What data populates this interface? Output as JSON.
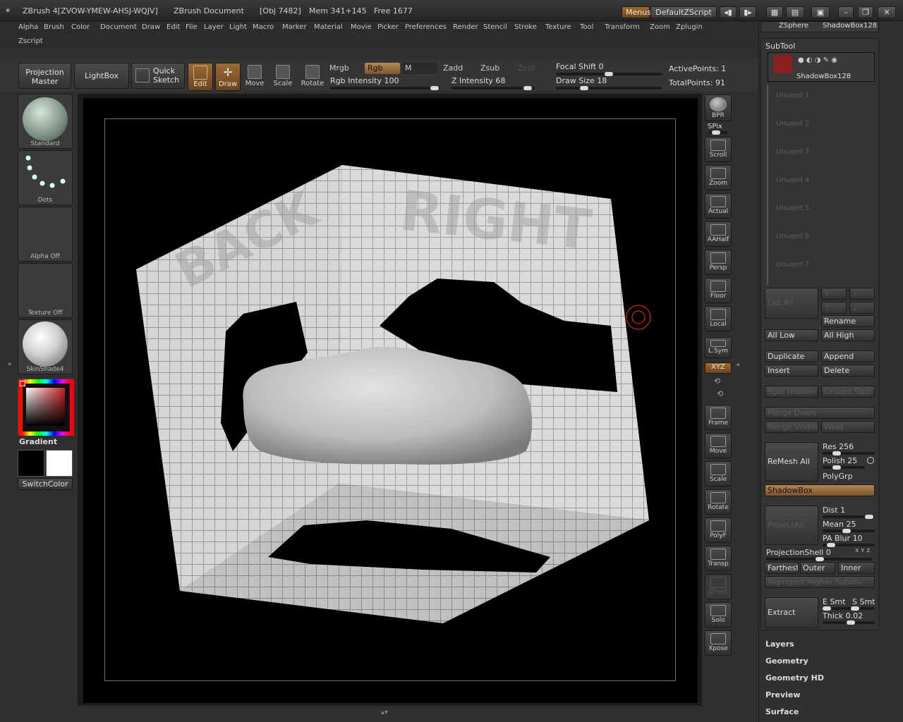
{
  "title_bar": {
    "app_title": "ZBrush 4[ZVOW-YMEW-AHSJ-WQJV]",
    "document": "ZBrush Document",
    "obj": "[Obj 7482]",
    "mem": "Mem 341+145",
    "free": "Free 1677",
    "menus_label": "Menus",
    "zscript_label": "DefaultZScript"
  },
  "menu_bar": {
    "items": [
      "Alpha",
      "Brush",
      "Color",
      "Document",
      "Draw",
      "Edit",
      "File",
      "Layer",
      "Light",
      "Macro",
      "Marker",
      "Material",
      "Movie",
      "Picker",
      "Preferences",
      "Render",
      "Stencil",
      "Stroke",
      "Texture",
      "Tool",
      "Transform",
      "Zoom",
      "Zplugin"
    ],
    "row2": "Zscript"
  },
  "toolbar": {
    "projection_master": "Projection Master",
    "lightbox": "LightBox",
    "quick_sketch": "Quick Sketch",
    "edit": "Edit",
    "draw": "Draw",
    "move": "Move",
    "scale": "Scale",
    "rotate": "Rotate",
    "mrgb": "Mrgb",
    "rgb": "Rgb",
    "m": "M",
    "zadd": "Zadd",
    "zsub": "Zsub",
    "zcut": "Zcut",
    "rgb_intensity_label": "Rgb Intensity",
    "rgb_intensity": "100",
    "z_intensity_label": "Z Intensity",
    "z_intensity": "68",
    "focal_shift_label": "Focal Shift",
    "focal_shift": "0",
    "draw_size_label": "Draw Size",
    "draw_size": "18",
    "active_points_label": "ActivePoints:",
    "active_points": "1",
    "total_points_label": "TotalPoints:",
    "total_points": "91"
  },
  "left_shelf": {
    "brush": "Standard",
    "stroke": "Dots",
    "alpha": "Alpha Off",
    "texture": "Texture Off",
    "material": "SkinShade4",
    "gradient": "Gradient",
    "switch_color": "SwitchColor"
  },
  "canvas": {
    "back_label": "BACK",
    "right_label": "RIGHT"
  },
  "right_shelf": {
    "items": [
      "BPR",
      "SPix",
      "Scroll",
      "Zoom",
      "Actual",
      "AAHalf",
      "Persp",
      "Floor",
      "Local",
      "L.Sym",
      "XYZ",
      "Frame",
      "Move",
      "Scale",
      "Rotate",
      "PolyF",
      "Transp",
      "Ghost",
      "Solo",
      "Xpose"
    ]
  },
  "right_panel": {
    "tool_current": "ZSphere",
    "tool_shadowbox": "ShadowBox128",
    "subtool_title": "SubTool",
    "subtool_item": "ShadowBox128",
    "unused": [
      "Unused 1",
      "Unused 2",
      "Unused 3",
      "Unused 4",
      "Unused 5",
      "Unused 6",
      "Unused 7"
    ],
    "list_all": "List All",
    "rename": "Rename",
    "all_low": "All Low",
    "all_high": "All High",
    "duplicate": "Duplicate",
    "append": "Append",
    "insert": "Insert",
    "delete": "Delete",
    "split_hidden": "Split Hidden",
    "groups_split": "Groups Split",
    "merge_down": "Merge Down",
    "merge_visible": "Merge Visible",
    "weld": "Weld",
    "remesh_all": "ReMesh All",
    "res_label": "Res",
    "res": "256",
    "polish_label": "Polish",
    "polish": "25",
    "polygrp": "PolyGrp",
    "shadowbox": "ShadowBox",
    "project_all": "ProjectAll",
    "dist_label": "Dist",
    "dist": "1",
    "mean_label": "Mean",
    "mean": "25",
    "pa_blur_label": "PA Blur",
    "pa_blur": "10",
    "projection_shell_label": "ProjectionShell",
    "projection_shell": "0",
    "farthest": "Farthest",
    "outer": "Outer",
    "inner": "Inner",
    "reproject": "Reproject Higher Subdiv",
    "extract": "Extract",
    "e_smt": "E Smt",
    "s_smt": "S Smt",
    "thick_label": "Thick",
    "thick": "0.02",
    "sections": [
      "Layers",
      "Geometry",
      "Geometry HD",
      "Preview",
      "Surface"
    ]
  },
  "colors": {
    "accent_orange": "#a8743a",
    "panel": "#303030",
    "canvas": "#000000"
  }
}
